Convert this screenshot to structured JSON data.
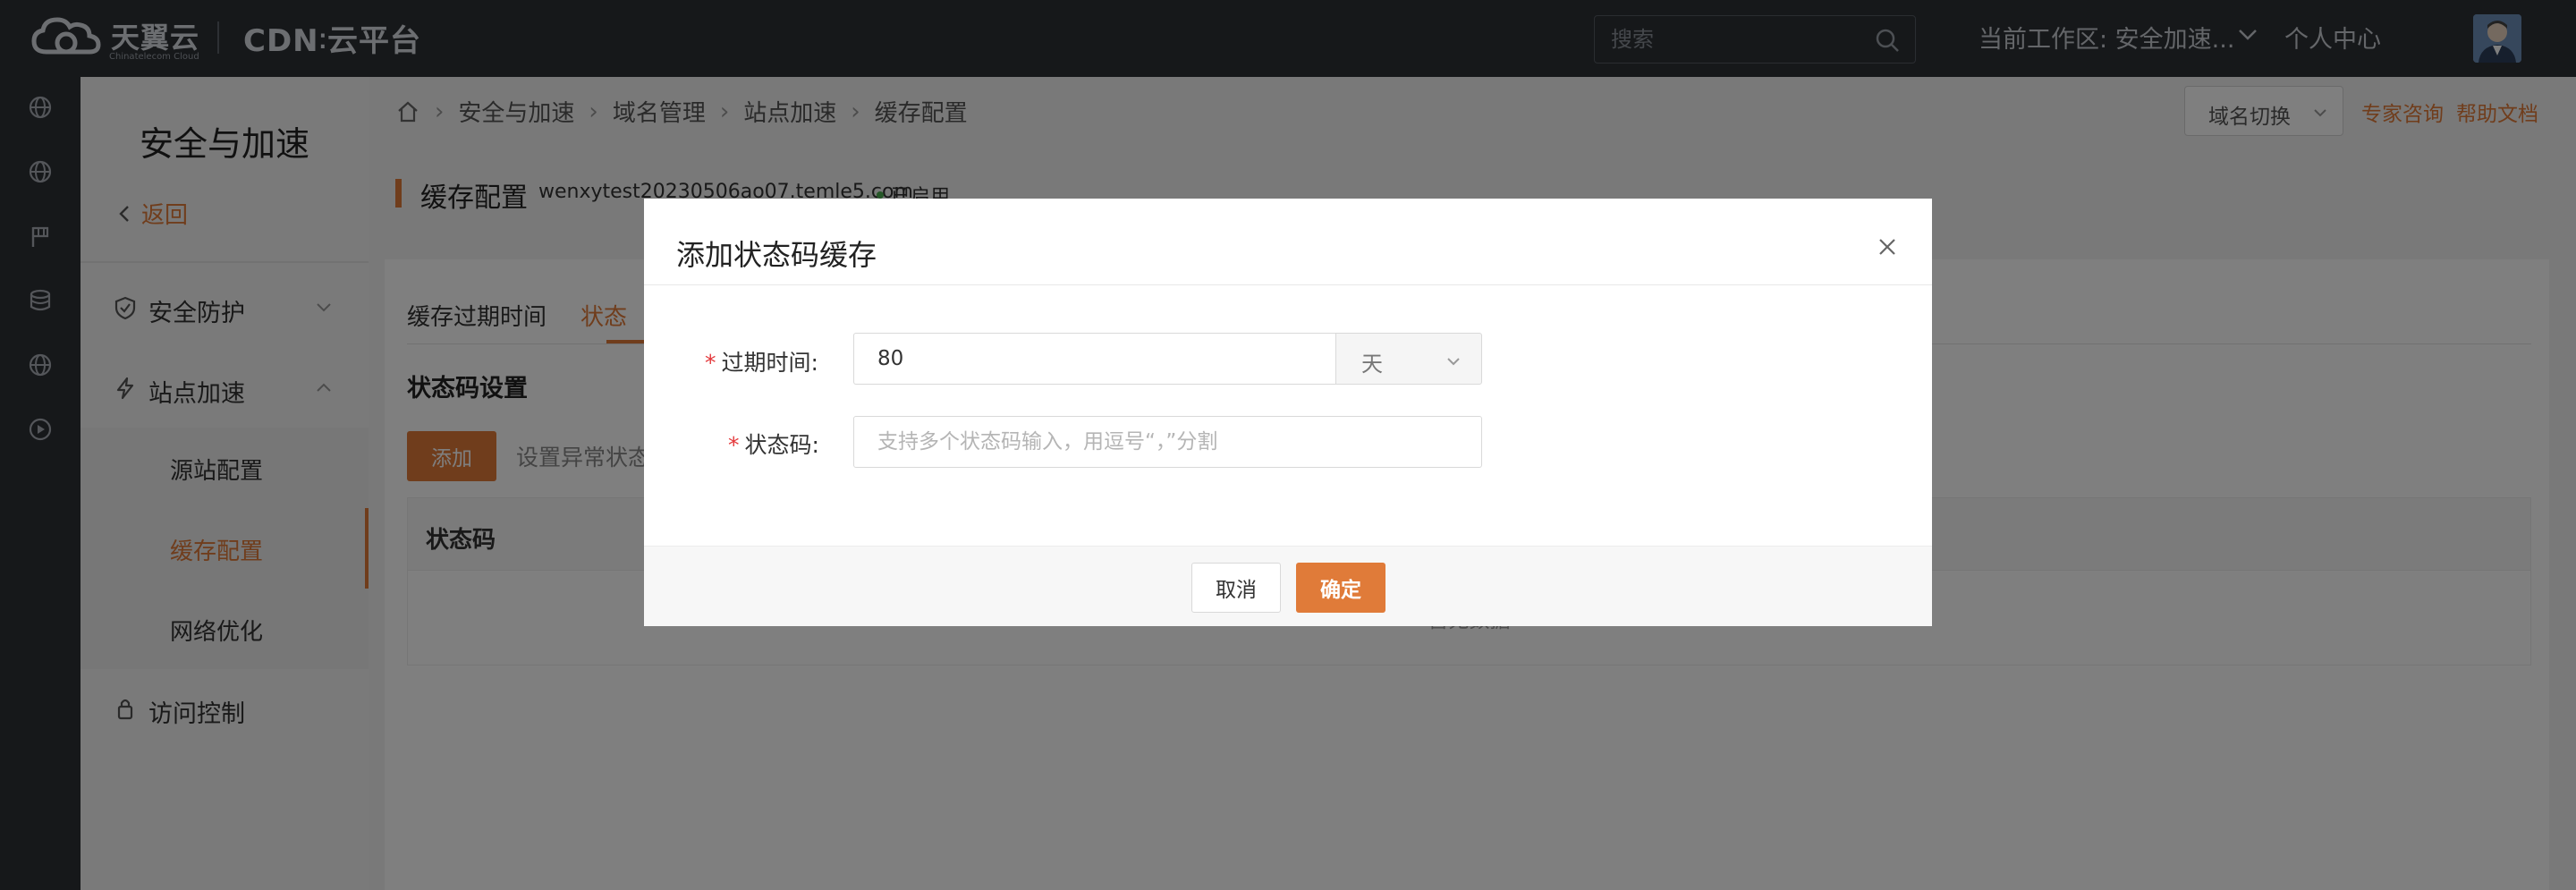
{
  "header": {
    "brand_cn": "天翼云",
    "brand_en": "Chinatelecom Cloud",
    "product": "CDN",
    "product_suffix": "云平台",
    "search_placeholder": "搜索",
    "workspace": "当前工作区: 安全加速...",
    "personal_center": "个人中心"
  },
  "rail": {
    "icons": [
      "globe-icon",
      "globe-icon",
      "flag-icon",
      "database-icon",
      "globe-icon",
      "play-circle-icon"
    ]
  },
  "sidebar": {
    "title": "安全与加速",
    "back_label": "返回",
    "groups": [
      {
        "label": "安全防护",
        "icon": "shield-check-icon",
        "expanded": false
      },
      {
        "label": "站点加速",
        "icon": "lightning-icon",
        "expanded": true,
        "items": [
          "源站配置",
          "缓存配置",
          "网络优化"
        ],
        "active_item": "缓存配置"
      },
      {
        "label": "访问控制",
        "icon": "lock-icon",
        "expanded": false
      }
    ]
  },
  "breadcrumb": [
    "安全与加速",
    "域名管理",
    "站点加速",
    "缓存配置"
  ],
  "toolbar": {
    "domain_switch": "域名切换",
    "expert": "专家咨询",
    "help": "帮助文档"
  },
  "page": {
    "title": "缓存配置",
    "domain": "wenxytest20230506ao07.temle5.com",
    "status": "已启用",
    "tabs": [
      "缓存过期时间",
      "状态"
    ],
    "active_tab": "状态",
    "section_title": "状态码设置",
    "add_label": "添加",
    "hint": "设置异常状态",
    "table_header": "状态码",
    "table_empty": "暂无数据"
  },
  "modal": {
    "title": "添加状态码缓存",
    "expire_label": "过期时间:",
    "expire_value": "80",
    "unit": "天",
    "code_label": "状态码:",
    "code_placeholder": "支持多个状态码输入，用逗号“，”分割",
    "cancel": "取消",
    "ok": "确定"
  },
  "colors": {
    "accent": "#e07b39",
    "topbar": "#2d3035",
    "required": "#e4393c",
    "status_dot": "#4caf50"
  }
}
